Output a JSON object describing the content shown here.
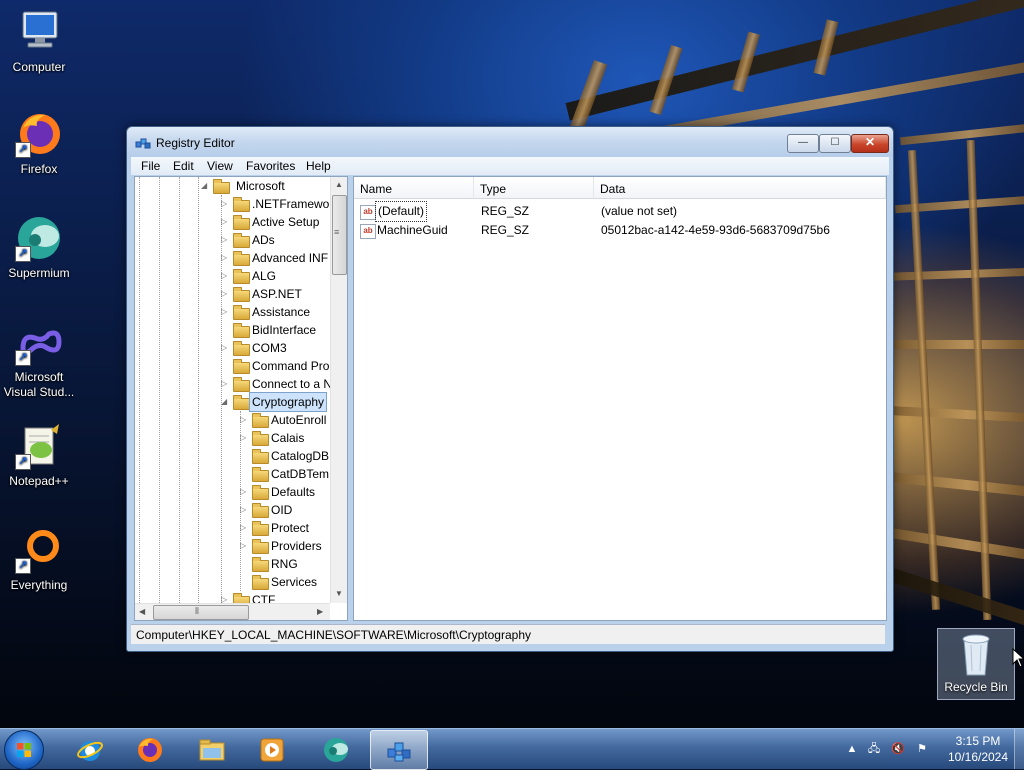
{
  "desktop": {
    "icons": [
      {
        "label": "Computer"
      },
      {
        "label": "Firefox"
      },
      {
        "label": "Supermium"
      },
      {
        "label": "Microsoft Visual Stud..."
      },
      {
        "label": "Notepad++"
      },
      {
        "label": "Everything"
      }
    ],
    "recycle_bin": {
      "label": "Recycle Bin"
    }
  },
  "window": {
    "title": "Registry Editor",
    "controls": {
      "minimize": "—",
      "maximize": "☐",
      "close": "✕"
    },
    "menu": [
      "File",
      "Edit",
      "View",
      "Favorites",
      "Help"
    ],
    "tree": {
      "parent": "Microsoft",
      "items": [
        ".NETFramewo",
        "Active Setup",
        "ADs",
        "Advanced INF",
        "ALG",
        "ASP.NET",
        "Assistance",
        "BidInterface",
        "COM3",
        "Command Pro",
        "Connect to a N"
      ],
      "selected": "Cryptography",
      "children": [
        "AutoEnroll",
        "Calais",
        "CatalogDB",
        "CatDBTem",
        "Defaults",
        "OID",
        "Protect",
        "Providers",
        "RNG",
        "Services"
      ],
      "partial": "CTF"
    },
    "list": {
      "columns": [
        "Name",
        "Type",
        "Data"
      ],
      "rows": [
        {
          "name": "(Default)",
          "type": "REG_SZ",
          "data": "(value not set)"
        },
        {
          "name": "MachineGuid",
          "type": "REG_SZ",
          "data": "05012bac-a142-4e59-93d6-5683709d75b6"
        }
      ]
    },
    "status": "Computer\\HKEY_LOCAL_MACHINE\\SOFTWARE\\Microsoft\\Cryptography"
  },
  "taskbar": {
    "pinned": [
      "internet-explorer-icon",
      "firefox-icon",
      "explorer-icon",
      "media-player-icon",
      "supermium-icon",
      "regedit-icon"
    ],
    "time": "3:15 PM",
    "date": "10/16/2024"
  }
}
